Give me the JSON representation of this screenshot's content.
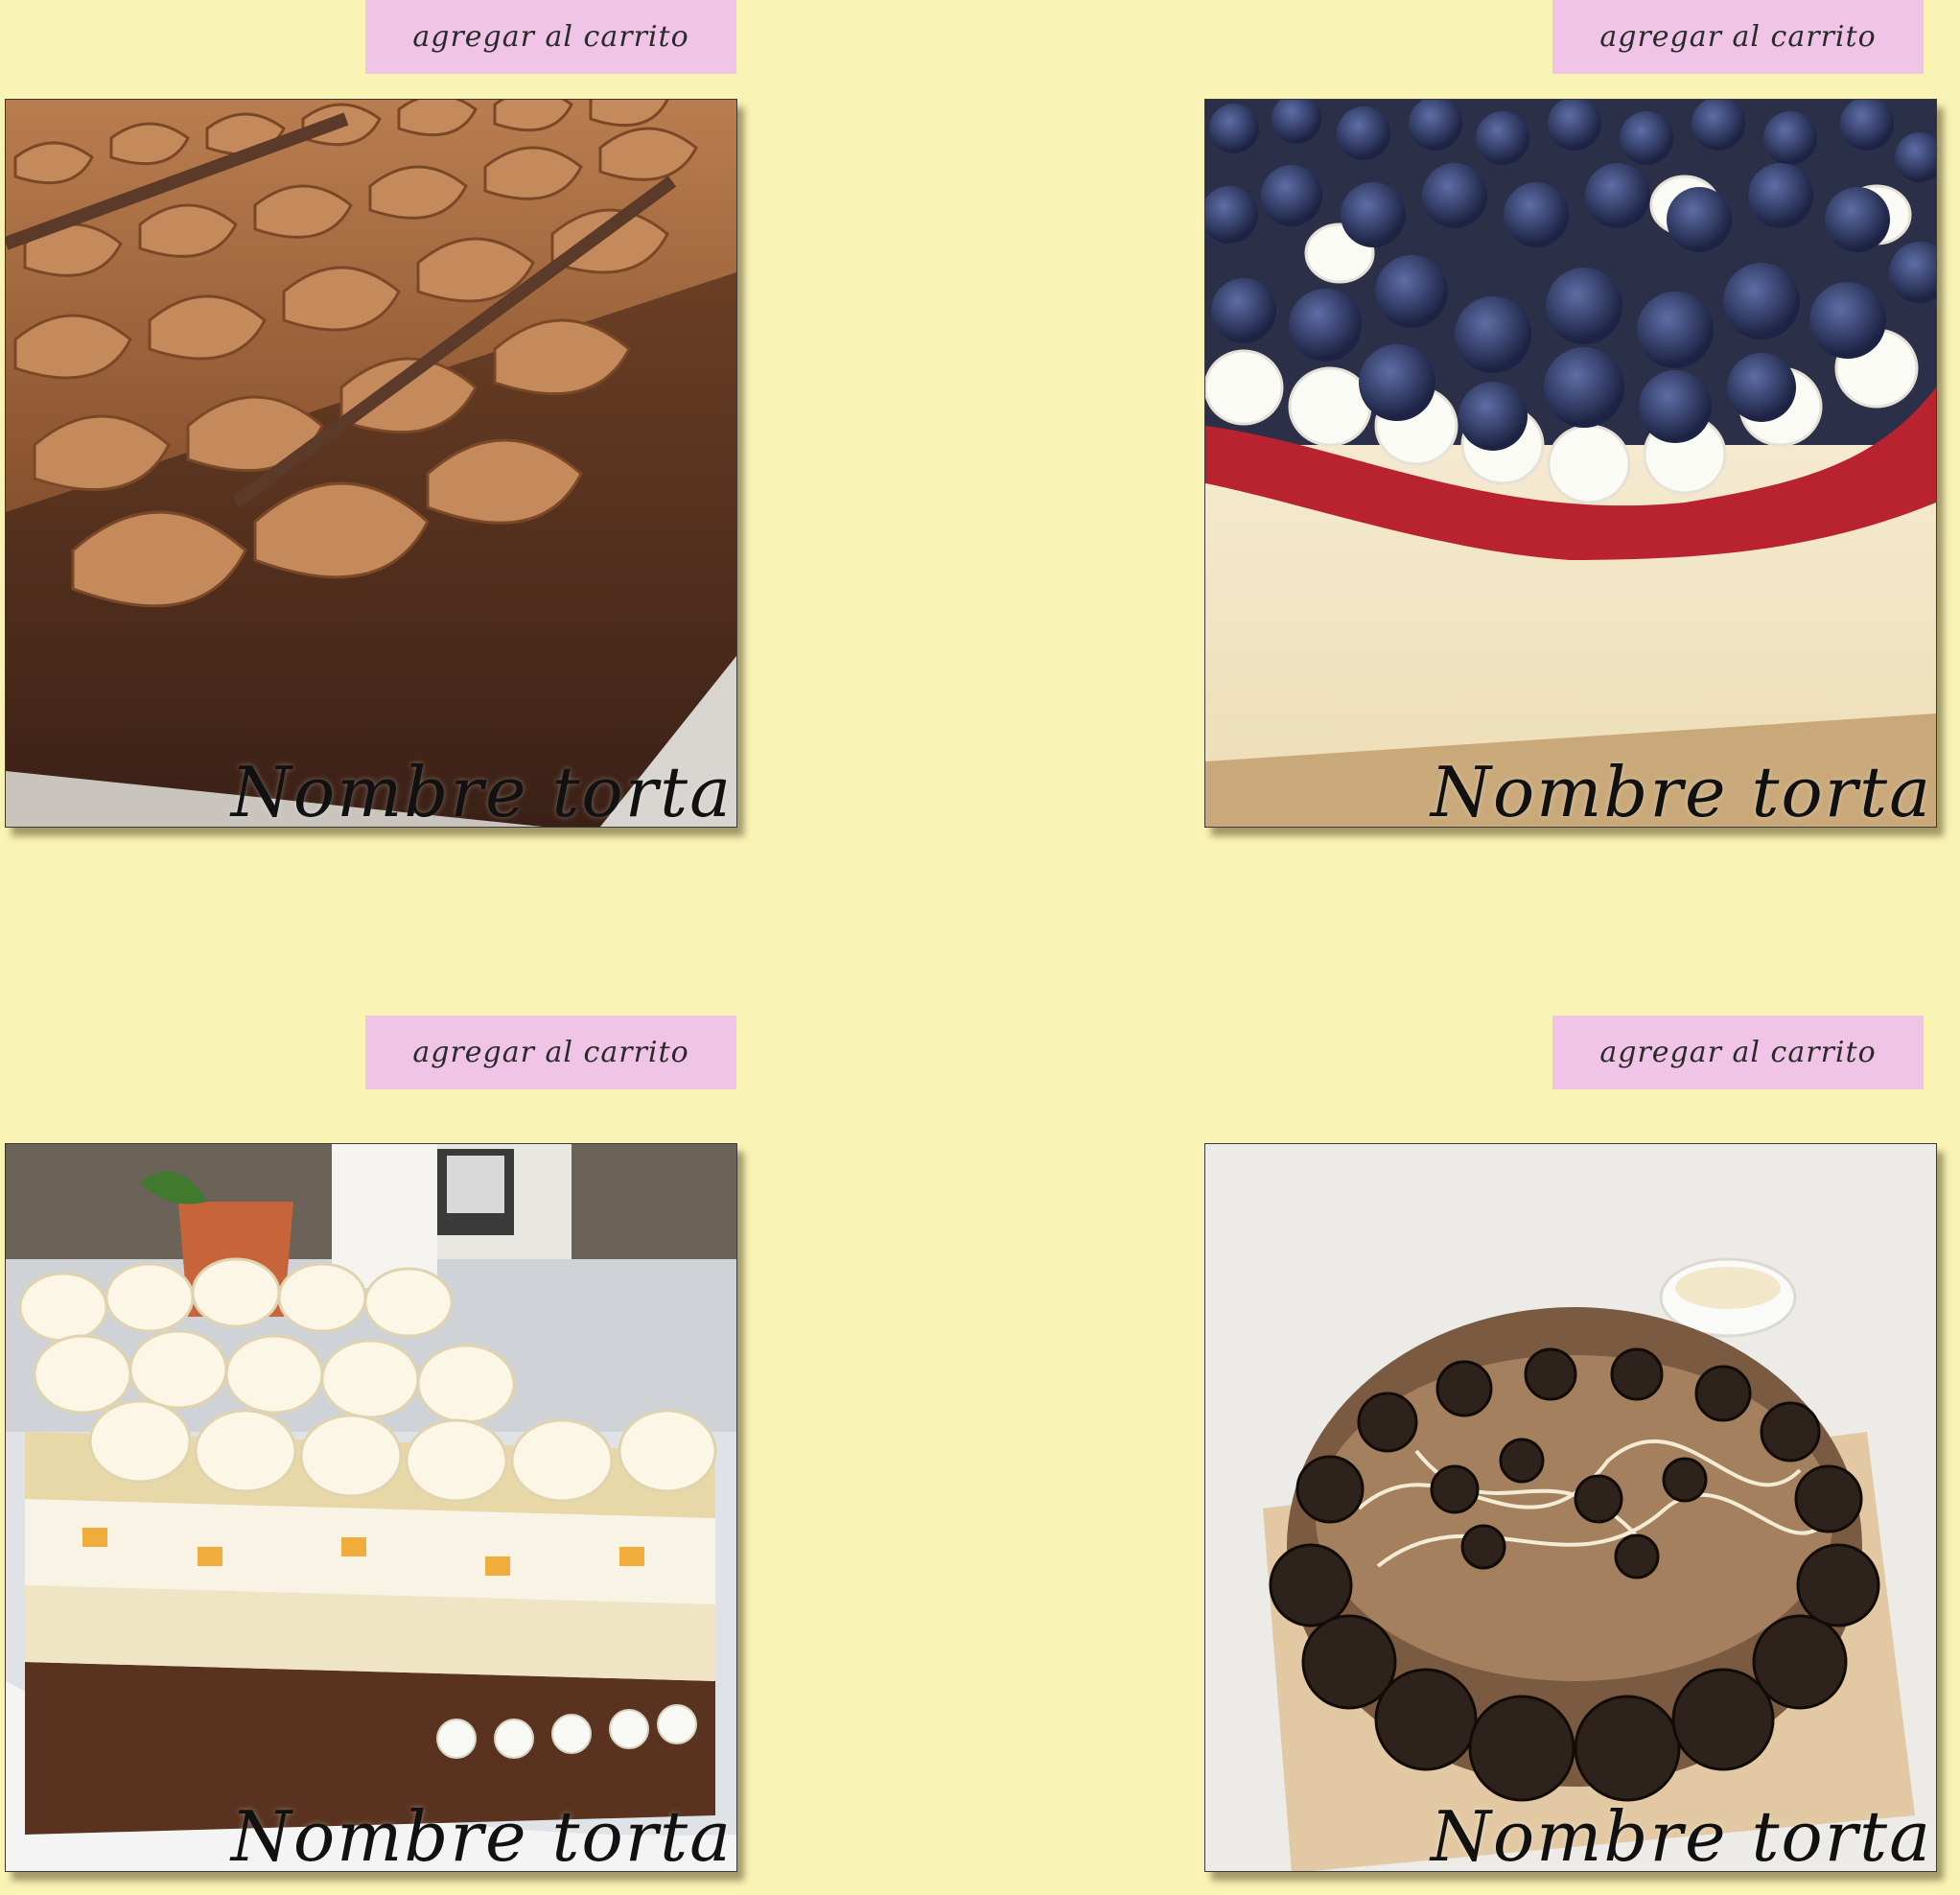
{
  "products": [
    {
      "cart_button_label": "agregar al carrito",
      "name": "Nombre torta",
      "photo_icon": "chocolate-cake-photo"
    },
    {
      "cart_button_label": "agregar al carrito",
      "name": "Nombre torta",
      "photo_icon": "blueberry-cheesecake-photo"
    },
    {
      "cart_button_label": "agregar al carrito",
      "name": "Nombre torta",
      "photo_icon": "cream-layer-cake-photo"
    },
    {
      "cart_button_label": "agregar al carrito",
      "name": "Nombre torta",
      "photo_icon": "oreo-cheesecake-photo"
    }
  ],
  "colors": {
    "page_background": "#faf3b6",
    "cart_button_background": "#f0c4e6",
    "text": "#111111"
  }
}
